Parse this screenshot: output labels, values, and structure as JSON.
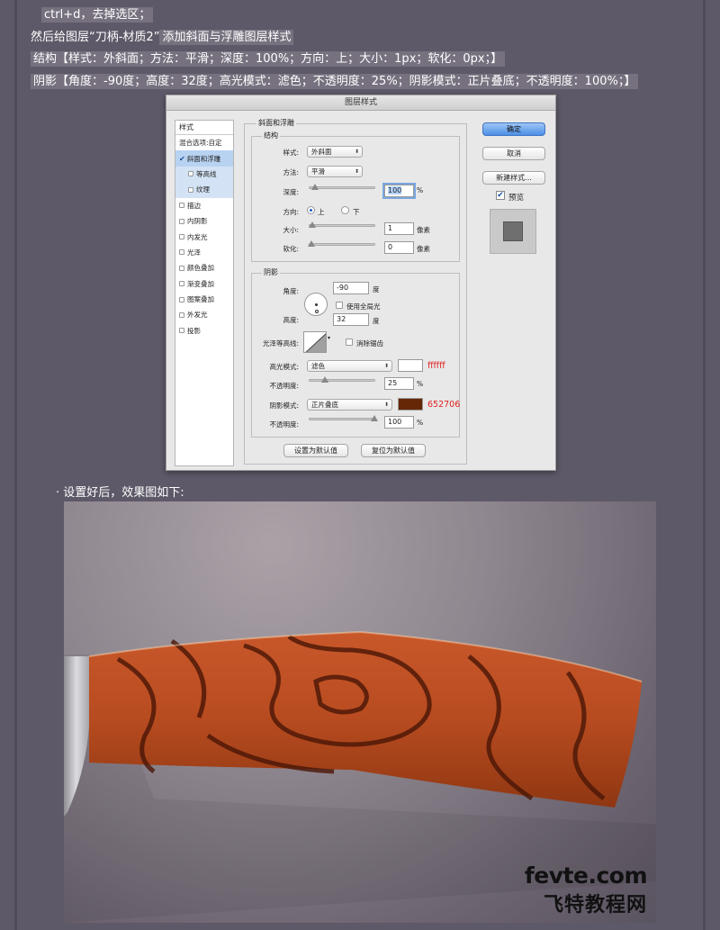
{
  "text_lines": {
    "l1": "ctrl+d，去掉选区；",
    "l2a": "然后给图层“刀柄-材质2”",
    "l2b": "添加斜面与浮雕图层样式",
    "l3": "结构【样式：外斜面；方法：平滑；深度：100%；方向：上；大小：1px；软化：0px；】",
    "l4": "阴影【角度：-90度；高度：32度；高光模式：滤色；不透明度：25%；阴影模式：正片叠底；不透明度：100%；】"
  },
  "dialog": {
    "title": "图层样式",
    "sidebar": {
      "header": "样式",
      "items": [
        {
          "label": "混合选项:自定"
        },
        {
          "label": "斜面和浮雕"
        },
        {
          "label": "等高线"
        },
        {
          "label": "纹理"
        },
        {
          "label": "描边"
        },
        {
          "label": "内阴影"
        },
        {
          "label": "内发光"
        },
        {
          "label": "光泽"
        },
        {
          "label": "颜色叠加"
        },
        {
          "label": "渐变叠加"
        },
        {
          "label": "图案叠加"
        },
        {
          "label": "外发光"
        },
        {
          "label": "投影"
        }
      ]
    },
    "bevel": {
      "title": "斜面和浮雕",
      "structure_title": "结构",
      "style_label": "样式:",
      "style_value": "外斜面",
      "technique_label": "方法:",
      "technique_value": "平滑",
      "depth_label": "深度:",
      "depth_value": "100",
      "depth_unit": "%",
      "direction_label": "方向:",
      "direction_up": "上",
      "direction_down": "下",
      "size_label": "大小:",
      "size_value": "1",
      "size_unit": "像素",
      "soften_label": "软化:",
      "soften_value": "0",
      "soften_unit": "像素"
    },
    "shading": {
      "title": "阴影",
      "angle_label": "角度:",
      "angle_value": "-90",
      "angle_unit": "度",
      "global_light": "使用全局光",
      "altitude_label": "高度:",
      "altitude_value": "32",
      "altitude_unit": "度",
      "gloss_label": "光泽等高线:",
      "anti_alias": "消除锯齿",
      "highlight_label": "高光模式:",
      "highlight_mode": "滤色",
      "highlight_color": "#ffffff",
      "highlight_hex": "ffffff",
      "highlight_opacity_label": "不透明度:",
      "highlight_opacity": "25",
      "highlight_opacity_unit": "%",
      "shadow_label": "阴影模式:",
      "shadow_mode": "正片叠底",
      "shadow_color": "#652706",
      "shadow_hex": "652706",
      "shadow_opacity_label": "不透明度:",
      "shadow_opacity": "100",
      "shadow_opacity_unit": "%"
    },
    "buttons": {
      "make_default": "设置为默认值",
      "reset_default": "复位为默认值",
      "ok": "确定",
      "cancel": "取消",
      "new_style": "新建样式...",
      "preview": "预览"
    }
  },
  "caption": "· 设置好后，效果图如下:",
  "watermark": {
    "line1": "fevte.com",
    "line2": "飞特教程网"
  }
}
